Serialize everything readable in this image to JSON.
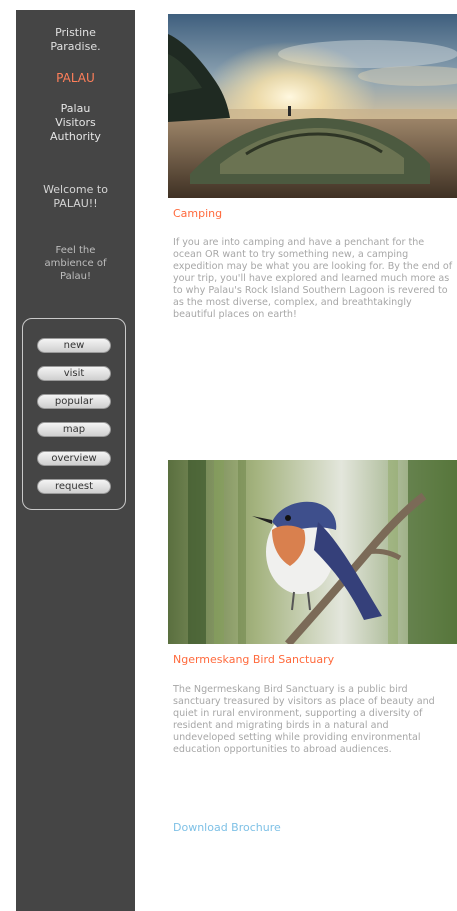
{
  "sidebar": {
    "tagline_line1": "Pristine",
    "tagline_line2": "Paradise.",
    "brand": "PALAU",
    "org_line1": "Palau",
    "org_line2": "Visitors",
    "org_line3": "Authority",
    "welcome_line1": "Welcome to",
    "welcome_line2": "PALAU!!",
    "feel_line1": "Feel the",
    "feel_line2": "ambience of",
    "feel_line3": "Palau!",
    "nav": [
      "new",
      "visit",
      "popular",
      "map",
      "overview",
      "request"
    ]
  },
  "cards": [
    {
      "title": "Camping",
      "body": "If you are into camping and have a penchant for the ocean OR want to try something new, a camping expedition may be what you are looking for. By the end of your trip, you'll have explored and learned much more as to why Palau's Rock Island Southern Lagoon is revered to as the most diverse, complex, and breathtakingly beautiful places on earth!"
    },
    {
      "title": "Ngermeskang Bird Sanctuary",
      "body": "The Ngermeskang Bird Sanctuary is a public bird sanctuary treasured by visitors as place of beauty and quiet in rural environment, supporting a diversity of resident and migrating birds in a natural and undeveloped setting while providing environmental education opportunities to abroad audiences."
    }
  ],
  "download_label": "Download Brochure"
}
